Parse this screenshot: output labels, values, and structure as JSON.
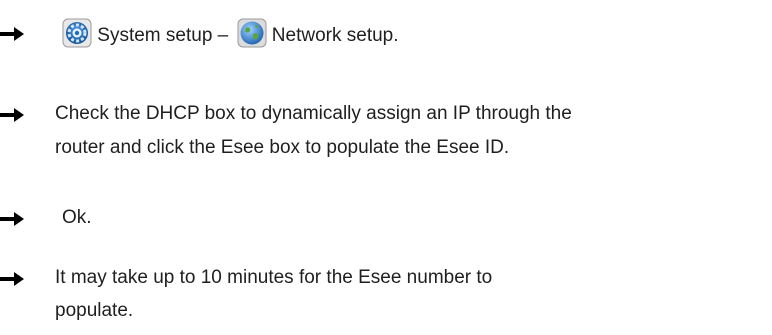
{
  "steps": [
    {
      "id": "step-1",
      "icon_a": "system-setup-gear-icon",
      "label_a": "System setup –",
      "icon_b": "network-globe-icon",
      "label_b": "Network setup."
    },
    {
      "id": "step-2",
      "line1": "Check the DHCP box to dynamically assign an IP through the",
      "line2": "router and click the Esee box to populate the Esee ID."
    },
    {
      "id": "step-3",
      "text": "Ok."
    },
    {
      "id": "step-4",
      "line1": "It may take up to 10 minutes for the Esee number to",
      "line2": "populate."
    }
  ],
  "colors": {
    "text": "#1f1f1f",
    "arrow": "#000000",
    "gear_blue": "#1f6fb8",
    "globe_blue": "#2b78d1"
  }
}
